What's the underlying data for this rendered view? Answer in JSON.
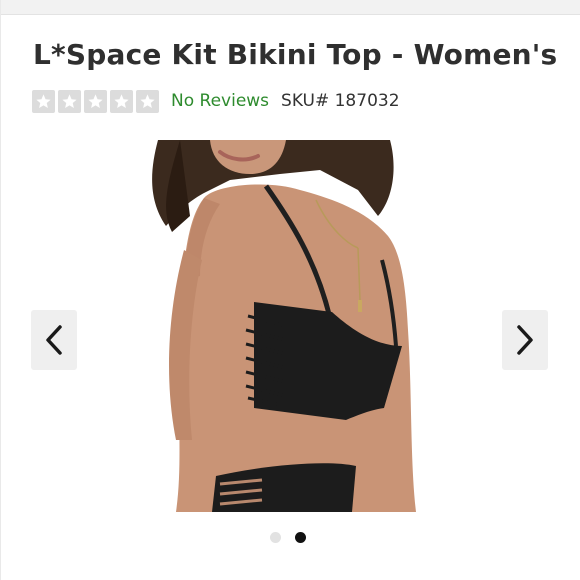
{
  "product": {
    "title": "L*Space Kit Bikini Top - Women's",
    "reviews_label": "No Reviews",
    "sku_label": "SKU# 187032"
  },
  "rating": {
    "stars_total": 5,
    "stars_filled": 0,
    "star_icon": "star-icon"
  },
  "gallery": {
    "image_alt": "L*Space Kit Bikini Top - Women's",
    "prev_icon": "chevron-left-icon",
    "next_icon": "chevron-right-icon",
    "slide_count": 2,
    "active_slide": 2
  },
  "colors": {
    "reviews_link": "#2e8b2e",
    "active_dot": "#111111",
    "inactive_dot": "#e2e2e2"
  }
}
